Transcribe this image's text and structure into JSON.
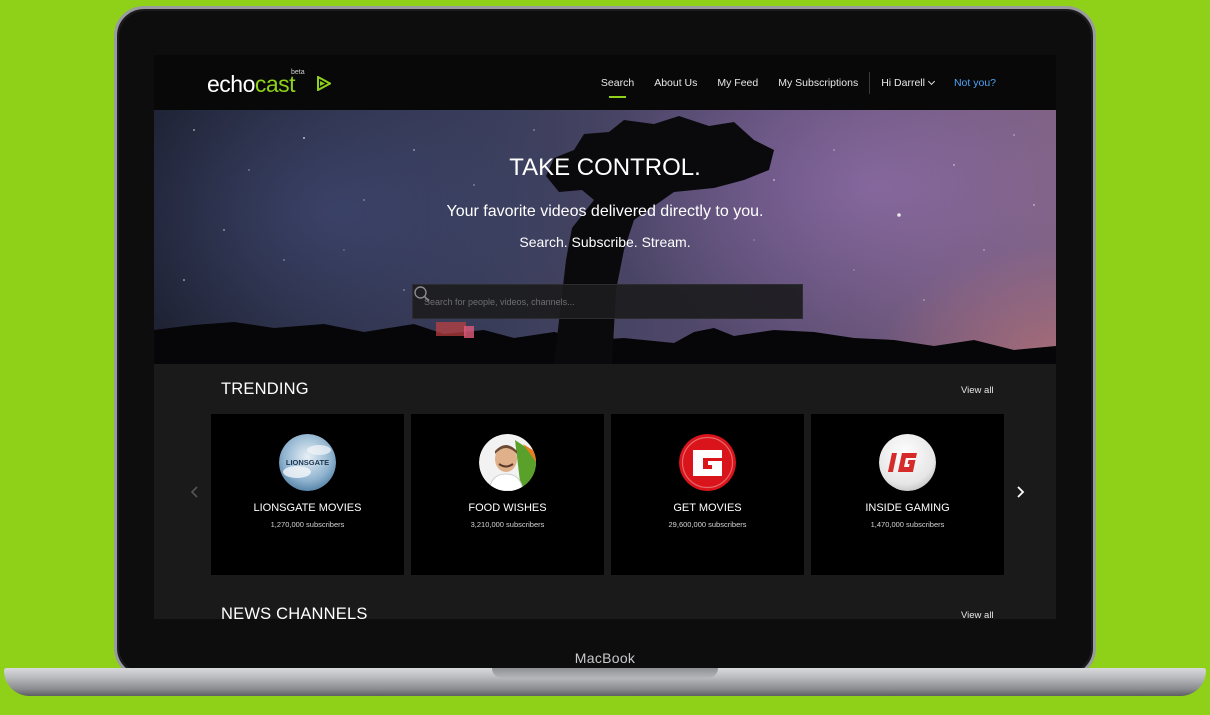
{
  "device": {
    "label": "MacBook"
  },
  "logo": {
    "text_main": "echo",
    "text_accent": "cast",
    "badge": "beta"
  },
  "nav": {
    "items": [
      {
        "label": "Search",
        "active": true
      },
      {
        "label": "About Us"
      },
      {
        "label": "My Feed"
      },
      {
        "label": "My Subscriptions"
      }
    ],
    "user_label": "Hi Darrell",
    "not_you_label": "Not you?"
  },
  "hero": {
    "title": "TAKE CONTROL.",
    "subtitle": "Your favorite videos delivered directly to you.",
    "tagline": "Search. Subscribe. Stream.",
    "search_placeholder": "Search for people, videos, channels..."
  },
  "trending": {
    "title": "TRENDING",
    "view_all": "View all",
    "channels": [
      {
        "name": "LIONSGATE MOVIES",
        "subscribers": "1,270,000 subscribers",
        "icon": "lionsgate-logo-icon"
      },
      {
        "name": "FOOD WISHES",
        "subscribers": "3,210,000 subscribers",
        "icon": "food-wishes-avatar-icon"
      },
      {
        "name": "GET MOVIES",
        "subscribers": "29,600,000 subscribers",
        "icon": "get-movies-logo-icon"
      },
      {
        "name": "INSIDE GAMING",
        "subscribers": "1,470,000 subscribers",
        "icon": "inside-gaming-logo-icon"
      }
    ]
  },
  "news": {
    "title": "NEWS CHANNELS",
    "view_all": "View all"
  },
  "colors": {
    "accent": "#8fd119",
    "link": "#4fa3f7",
    "background": "#1a1a1a",
    "card": "#000000"
  }
}
